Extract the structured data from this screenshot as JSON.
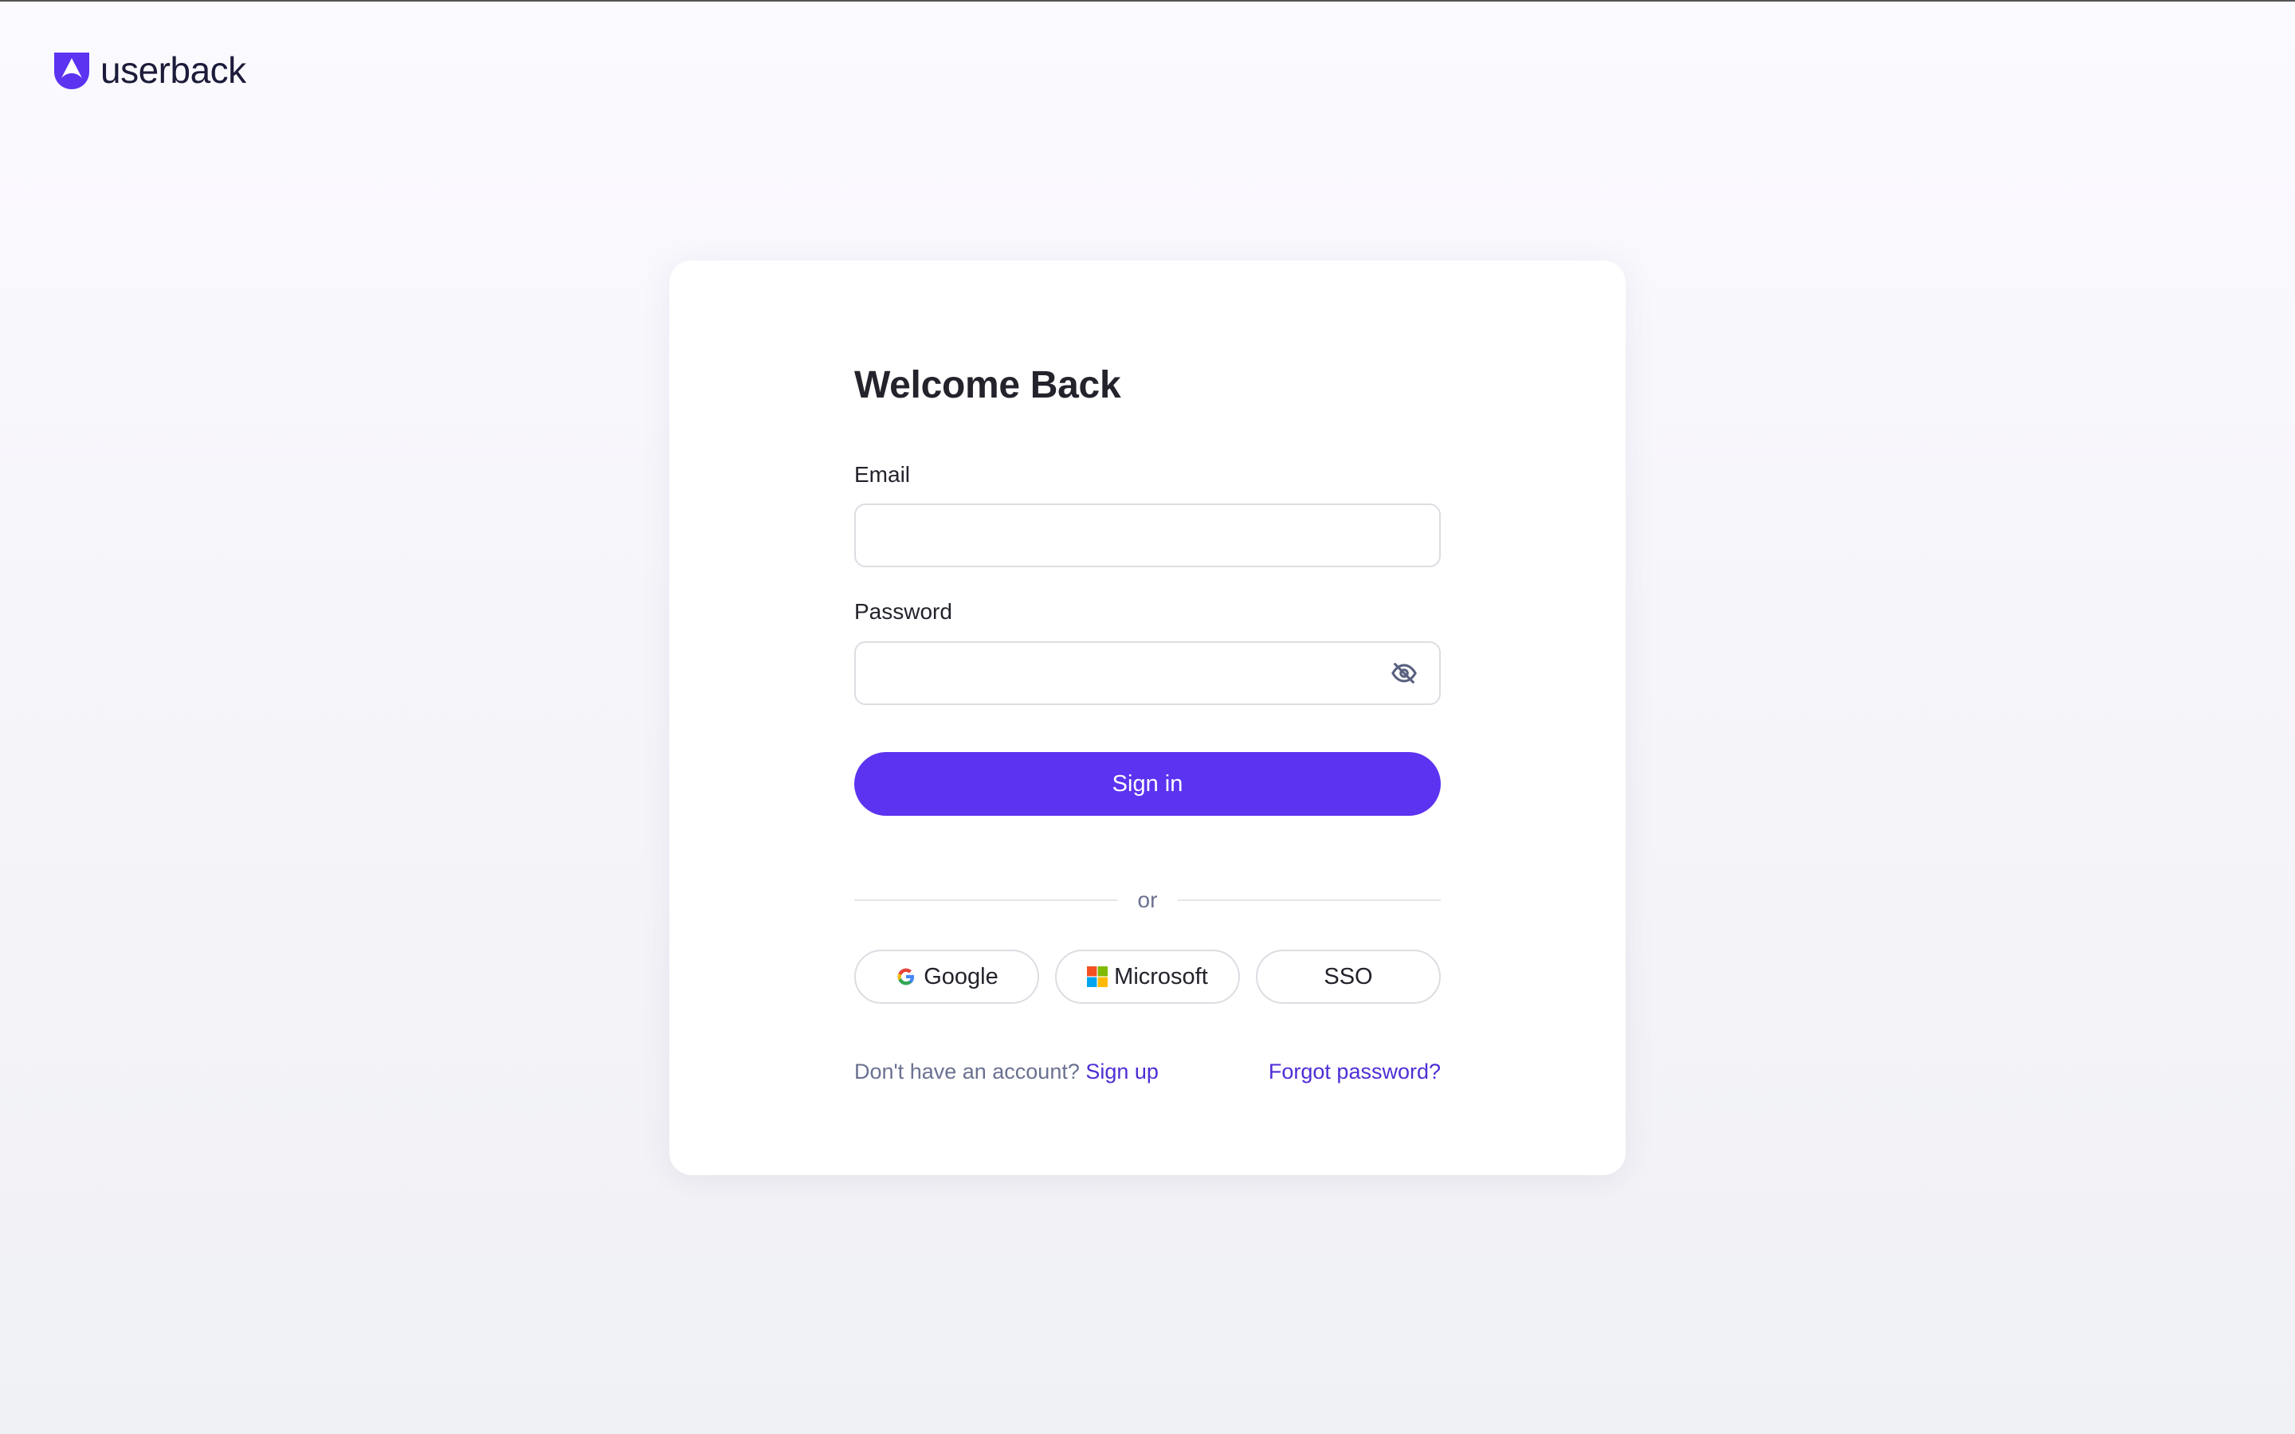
{
  "brand": {
    "name": "userback",
    "icon": "userback-logo-icon",
    "color": "#5c33f0"
  },
  "login": {
    "title": "Welcome Back",
    "email_label": "Email",
    "email_value": "",
    "password_label": "Password",
    "password_value": "",
    "password_toggle_icon": "eye-off-icon",
    "submit_label": "Sign in",
    "divider_text": "or"
  },
  "providers": [
    {
      "label": "Google",
      "icon": "google-icon"
    },
    {
      "label": "Microsoft",
      "icon": "microsoft-icon"
    },
    {
      "label": "SSO",
      "icon": ""
    }
  ],
  "footer": {
    "signup_prompt": "Don't have an account?",
    "signup_link": "Sign up",
    "forgot_link": "Forgot password?"
  },
  "colors": {
    "primary": "#5c33f0",
    "link": "#4f2dd6",
    "text": "#24222b",
    "muted": "#6b7191",
    "border": "#dcdde2"
  }
}
